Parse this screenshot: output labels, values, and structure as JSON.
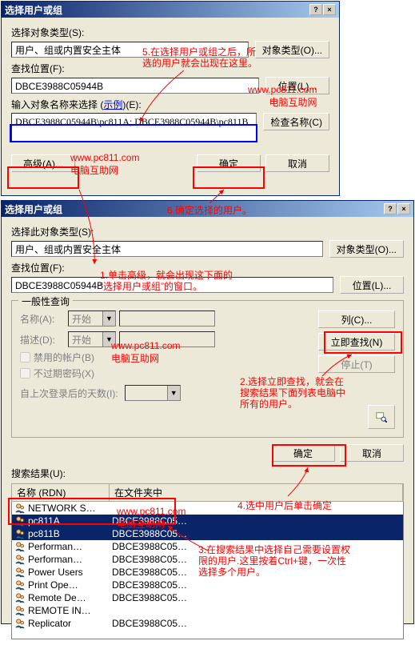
{
  "win1": {
    "title": "选择用户或组",
    "obj_type_label": "选择对象类型(S):",
    "obj_type_value": "用户、组或内置安全主体",
    "btn_obj_types": "对象类型(O)...",
    "location_label": "查找位置(F):",
    "location_value": "DBCE3988C05944B",
    "btn_location": "位置(L)...",
    "names_label": "输入对象名称来选择 (",
    "names_link": "示例",
    "names_label2": ")(E):",
    "names_value": "DBCE3988C05944B\\pc811A; DBCE3988C05944B\\pc811B",
    "btn_check": "检查名称(C)",
    "btn_advanced": "高级(A)...",
    "btn_ok": "确定",
    "btn_cancel": "取消"
  },
  "win2": {
    "title": "选择用户或组",
    "obj_type_label": "选择此对象类型(S):",
    "obj_type_value": "用户、组或内置安全主体",
    "btn_obj_types": "对象类型(O)...",
    "location_label": "查找位置(F):",
    "location_value": "DBCE3988C05944B",
    "btn_location": "位置(L)...",
    "common_queries": "一般性查询",
    "name_label": "名称(A):",
    "name_combo": "开始",
    "desc_label": "描述(D):",
    "desc_combo": "开始",
    "chk_disabled": "禁用的帐户(B)",
    "chk_noexpire": "不过期密码(X)",
    "lastlogon_label": "自上次登录后的天数(I):",
    "btn_columns": "列(C)...",
    "btn_findnow": "立即查找(N)",
    "btn_stop": "停止(T)",
    "btn_ok": "确定",
    "btn_cancel": "取消",
    "results_label": "搜索结果(U):",
    "col_name": "名称 (RDN)",
    "col_folder": "在文件夹中",
    "rows": [
      {
        "name": "NETWORK S…",
        "folder": "",
        "sel": false
      },
      {
        "name": "pc811A",
        "folder": "DBCE3988C05…",
        "sel": true
      },
      {
        "name": "pc811B",
        "folder": "DBCE3988C05…",
        "sel": true
      },
      {
        "name": "Performan…",
        "folder": "DBCE3988C05…",
        "sel": false
      },
      {
        "name": "Performan…",
        "folder": "DBCE3988C05…",
        "sel": false
      },
      {
        "name": "Power Users",
        "folder": "DBCE3988C05…",
        "sel": false
      },
      {
        "name": "Print Ope…",
        "folder": "DBCE3988C05…",
        "sel": false
      },
      {
        "name": "Remote De…",
        "folder": "DBCE3988C05…",
        "sel": false
      },
      {
        "name": "REMOTE IN…",
        "folder": "",
        "sel": false
      },
      {
        "name": "Replicator",
        "folder": "DBCE3988C05…",
        "sel": false
      }
    ]
  },
  "anno": {
    "a1": "1.单击高级，就会出现这下面的\n“选择用户或组”的窗口。",
    "a2": "2.选择立即查找，就会在\n搜索结果下面列表电脑中\n所有的用户。",
    "a3": "3.在搜索结果中选择自己需要设置权\n限的用户.这里按着Ctrl+键，一次性\n选择多个用户。",
    "a4": "4.选中用户后单击确定",
    "a5": "5.在选择用户或组之后，所\n选的用户就会出现在这里。",
    "a6": "6.确定选择的用户。",
    "wm1": "www.pc811.com\n电脑互助网",
    "wm2": "www.pc811.com\n电脑互助网",
    "wm3": "www.pc811.com\n电脑互助网",
    "wm4": "www.pc811.com\n电脑互助网"
  }
}
